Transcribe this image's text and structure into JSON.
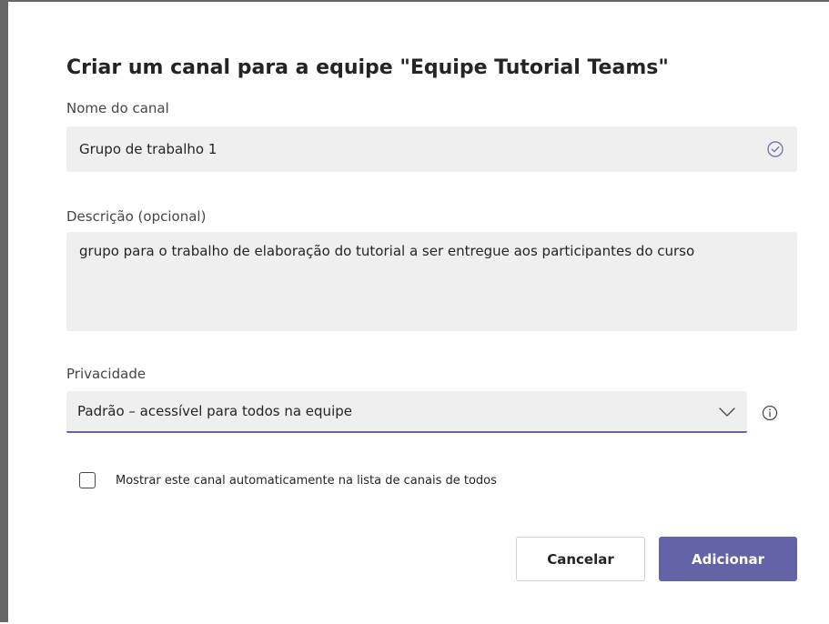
{
  "dialog": {
    "title": "Criar um canal para a equipe \"Equipe Tutorial Teams\"",
    "name": {
      "label": "Nome do canal",
      "value": "Grupo de trabalho 1",
      "status_icon": "check-circle-icon"
    },
    "description": {
      "label": "Descrição (opcional)",
      "value": "grupo para o trabalho de elaboração do tutorial a ser entregue aos participantes do curso"
    },
    "privacy": {
      "label": "Privacidade",
      "selected": "Padrão – acessível para todos na equipe",
      "dropdown_icon": "chevron-down-icon",
      "info_icon": "info-icon"
    },
    "auto_show": {
      "label": "Mostrar este canal automaticamente na lista de canais de todos",
      "checked": false
    },
    "buttons": {
      "cancel": "Cancelar",
      "add": "Adicionar"
    }
  },
  "colors": {
    "accent": "#6264a7",
    "field_bg": "#f0efef",
    "text": "#252423",
    "label": "#484644"
  }
}
